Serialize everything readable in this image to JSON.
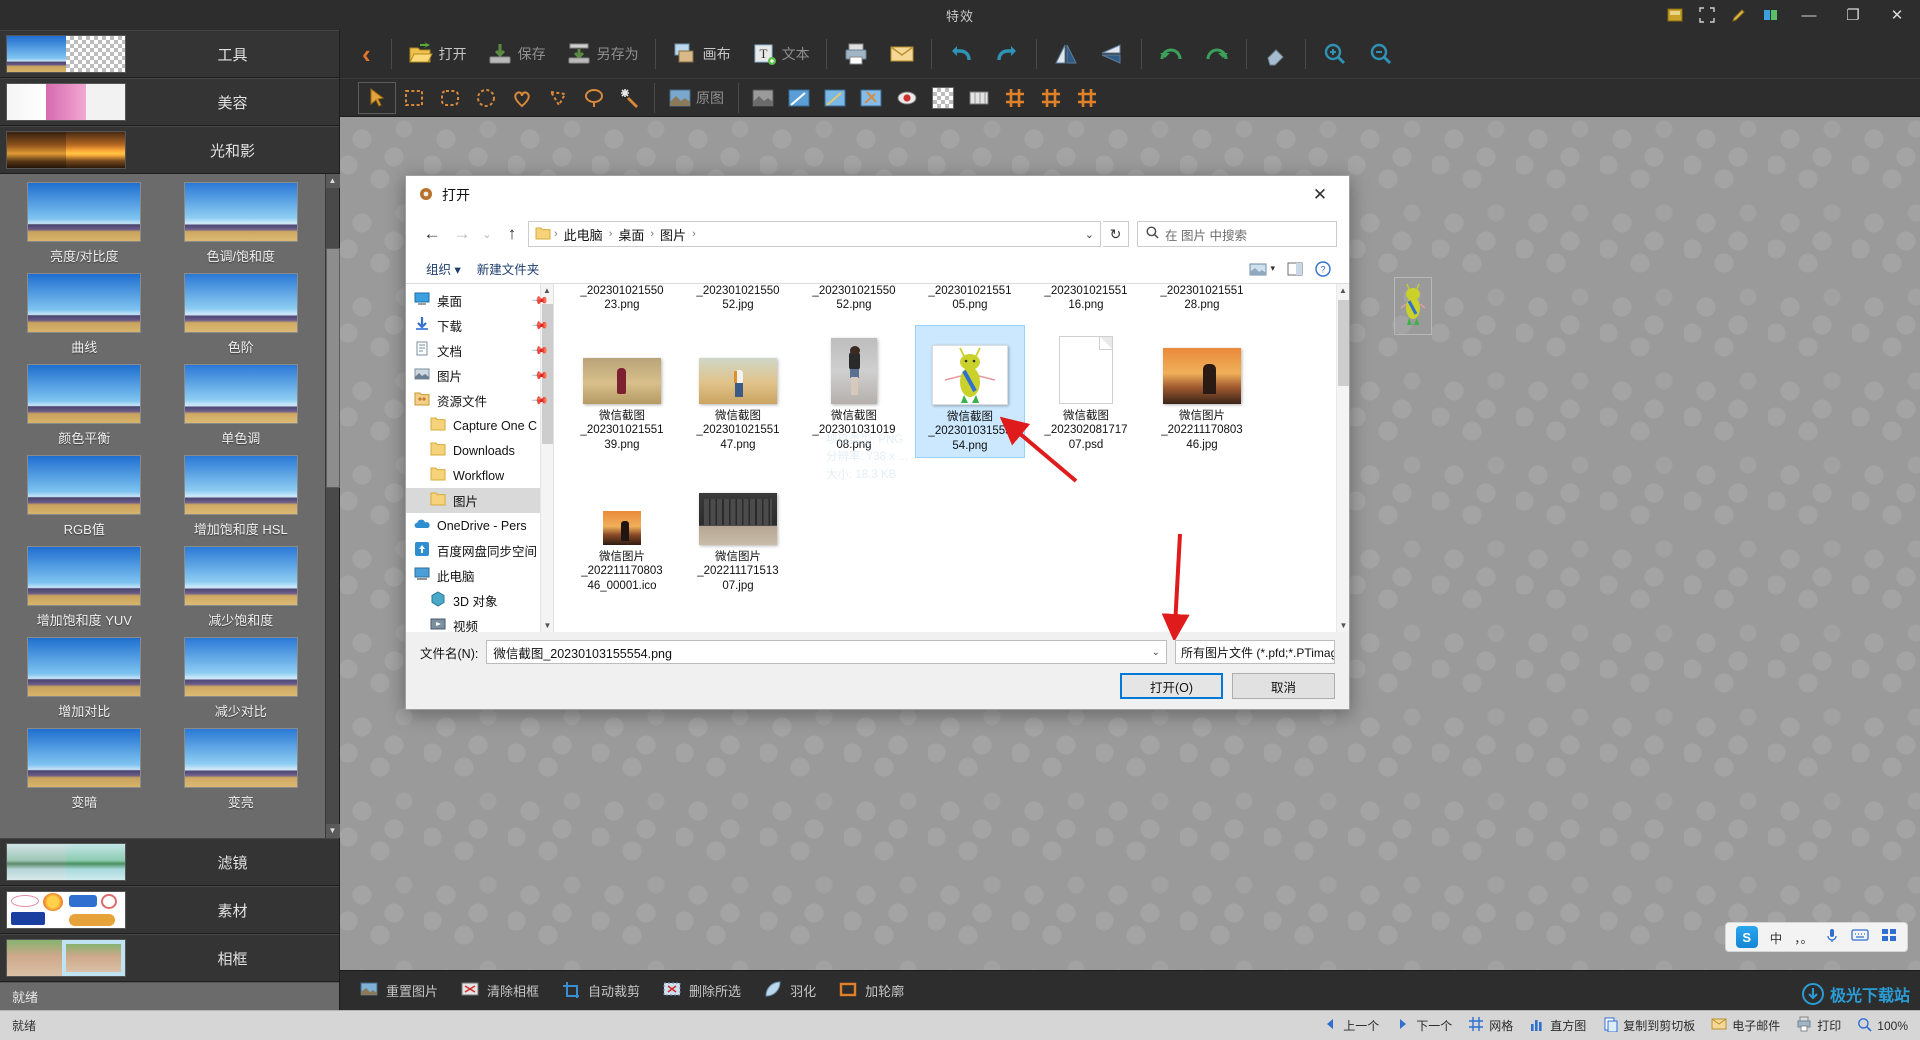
{
  "window": {
    "title": "特效",
    "minimize": "—",
    "maximize": "❐",
    "close": "✕"
  },
  "toolbar": {
    "back_icon": "‹",
    "items": [
      {
        "label": "打开",
        "icon": "open-folder-icon",
        "dim": false
      },
      {
        "label": "保存",
        "icon": "save-icon",
        "dim": true
      },
      {
        "label": "另存为",
        "icon": "save-as-icon",
        "dim": true
      },
      {
        "label": "画布",
        "icon": "canvas-icon",
        "dim": false
      },
      {
        "label": "文本",
        "icon": "text-tool-icon",
        "dim": true
      }
    ],
    "icon_only": [
      "print-icon",
      "email-icon",
      "undo-icon",
      "redo-icon",
      "flip-horizontal-icon",
      "flip-vertical-icon",
      "rotate-left-icon",
      "rotate-right-icon",
      "eraser-icon",
      "zoom-in-icon",
      "zoom-out-icon"
    ],
    "row2_original_label": "原图",
    "row2_icons": [
      "cursor-icon",
      "rect-select-icon",
      "rounded-select-icon",
      "ellipse-select-icon",
      "heart-select-icon",
      "polygon-select-icon",
      "lasso-select-icon",
      "magic-wand-icon"
    ]
  },
  "sidebar": {
    "categories_top": [
      {
        "label": "工具",
        "thumb": "tool-thumb"
      },
      {
        "label": "美容",
        "thumb": "beauty-thumb"
      },
      {
        "label": "光和影",
        "thumb": "light-shadow-thumb"
      }
    ],
    "categories_bottom": [
      {
        "label": "滤镜",
        "thumb": "filter-thumb"
      },
      {
        "label": "素材",
        "thumb": "material-thumb"
      },
      {
        "label": "相框",
        "thumb": "frame-thumb"
      }
    ],
    "effects": [
      "亮度/对比度",
      "色调/饱和度",
      "曲线",
      "色阶",
      "颜色平衡",
      "单色调",
      "RGB值",
      "增加饱和度 HSL",
      "增加饱和度 YUV",
      "减少饱和度",
      "增加对比",
      "减少对比",
      "变暗",
      "变亮"
    ],
    "status": "就绪"
  },
  "bottombar": {
    "items": [
      {
        "label": "重置图片",
        "icon": "reset-image-icon"
      },
      {
        "label": "清除相框",
        "icon": "clear-frame-icon"
      },
      {
        "label": "自动裁剪",
        "icon": "auto-crop-icon"
      },
      {
        "label": "删除所选",
        "icon": "delete-selection-icon"
      },
      {
        "label": "羽化",
        "icon": "feather-icon"
      },
      {
        "label": "加轮廓",
        "icon": "outline-icon"
      }
    ]
  },
  "taskbar": {
    "status": "就绪",
    "items": [
      {
        "label": "上一个",
        "icon": "prev-icon"
      },
      {
        "label": "下一个",
        "icon": "next-icon"
      },
      {
        "label": "网格",
        "icon": "grid-icon"
      },
      {
        "label": "直方图",
        "icon": "histogram-icon"
      },
      {
        "label": "复制到剪切板",
        "icon": "copy-clipboard-icon"
      },
      {
        "label": "电子邮件",
        "icon": "email-icon"
      },
      {
        "label": "打印",
        "icon": "print-icon"
      }
    ],
    "zoom": "100%"
  },
  "dialog": {
    "title": "打开",
    "close": "✕",
    "nav": {
      "back": "←",
      "forward": "→",
      "recent": "⌄",
      "up": "↑",
      "refresh": "↻",
      "caret": "⌄"
    },
    "breadcrumbs": [
      "此电脑",
      "桌面",
      "图片"
    ],
    "search_placeholder": "在 图片 中搜索",
    "commands": {
      "organize": "组织",
      "organize_caret": "▾",
      "new_folder": "新建文件夹"
    },
    "tree": [
      {
        "label": "桌面",
        "icon": "desktop-icon",
        "pin": true,
        "indent": "root"
      },
      {
        "label": "下载",
        "icon": "download-icon",
        "pin": true,
        "indent": "root"
      },
      {
        "label": "文档",
        "icon": "documents-icon",
        "pin": true,
        "indent": "root"
      },
      {
        "label": "图片",
        "icon": "pictures-icon",
        "pin": true,
        "indent": "root"
      },
      {
        "label": "资源文件",
        "icon": "resource-folder-icon",
        "pin": true,
        "indent": "root"
      },
      {
        "label": "Capture One C",
        "icon": "folder-icon",
        "pin": false,
        "indent": "child"
      },
      {
        "label": "Downloads",
        "icon": "folder-icon",
        "pin": false,
        "indent": "child"
      },
      {
        "label": "Workflow",
        "icon": "folder-icon",
        "pin": false,
        "indent": "child"
      },
      {
        "label": "图片",
        "icon": "folder-icon",
        "pin": false,
        "indent": "child",
        "selected": true
      },
      {
        "label": "OneDrive - Pers",
        "icon": "onedrive-icon",
        "pin": false,
        "indent": "root"
      },
      {
        "label": "百度网盘同步空间",
        "icon": "baidu-netdisk-icon",
        "pin": false,
        "indent": "root"
      },
      {
        "label": "此电脑",
        "icon": "this-pc-icon",
        "pin": false,
        "indent": "root"
      },
      {
        "label": "3D 对象",
        "icon": "3d-objects-icon",
        "pin": false,
        "indent": "child"
      },
      {
        "label": "视频",
        "icon": "videos-icon",
        "pin": false,
        "indent": "child"
      }
    ],
    "files_row0": [
      "_202301021550\n23.png",
      "_202301021550\n52.jpg",
      "_202301021550\n52.png",
      "_202301021551\n05.png",
      "_202301021551\n16.png",
      "_202301021551\n28.png"
    ],
    "files_row1": [
      {
        "name": "微信截图\n_202301021551\n39.png",
        "thumb": "field-girl-red",
        "selected": false
      },
      {
        "name": "微信截图\n_202301021551\n47.png",
        "thumb": "field-girl-white",
        "selected": false
      },
      {
        "name": "微信截图\n_202301031019\n08.png",
        "thumb": "street-girl",
        "selected": false
      },
      {
        "name": "微信截图\n_202301031555\n54.png",
        "thumb": "green-doll",
        "selected": true
      },
      {
        "name": "微信截图\n_202302081717\n07.psd",
        "thumb": "blank-doc",
        "selected": false
      },
      {
        "name": "微信图片\n_202211170803\n46.jpg",
        "thumb": "sunset-girl",
        "selected": false
      }
    ],
    "files_row2": [
      {
        "name": "微信图片\n_202211170803\n46_00001.ico",
        "thumb": "sunset-small"
      },
      {
        "name": "微信图片\n_202211171513\n07.jpg",
        "thumb": "keyboard"
      }
    ],
    "tooltip": "项目类型: PNG\n分辨率: 738 x ...\n大小: 18.3 KB",
    "filename_label": "文件名(N):",
    "filename_value": "微信截图_20230103155554.png",
    "filetype_value": "所有图片文件 (*.pfd;*.PTimage",
    "open_button": "打开(O)",
    "cancel_button": "取消"
  },
  "ime": {
    "lang": "中",
    "punct": "，。",
    "mic": "mic-icon",
    "keyboard": "keyboard-icon",
    "panel": "panel-icon"
  },
  "watermark": "极光下载站",
  "colors": {
    "accent_orange": "#e2762a",
    "selection_blue": "#cce8ff",
    "primary_border": "#0078d7",
    "arrow_red": "#e01b1b"
  }
}
